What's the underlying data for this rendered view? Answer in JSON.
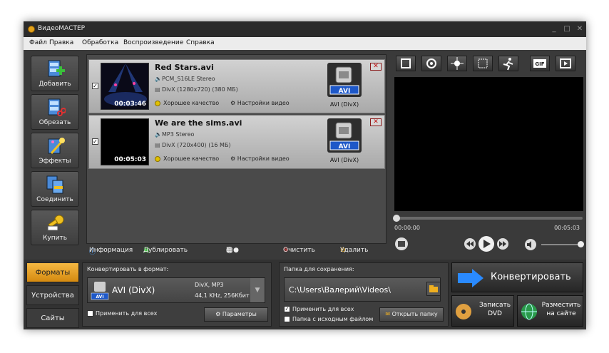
{
  "window": {
    "title": "ВидеоМАСТЕР",
    "controls": [
      "_",
      "□",
      "✕"
    ]
  },
  "menu": [
    "Файл",
    "Правка",
    "Обработка",
    "Воспроизведение",
    "Справка"
  ],
  "sidebar": [
    {
      "label": "Добавить",
      "icon": "add-video-icon"
    },
    {
      "label": "Обрезать",
      "icon": "cut-video-icon"
    },
    {
      "label": "Эффекты",
      "icon": "effects-icon"
    },
    {
      "label": "Соединить",
      "icon": "join-video-icon"
    },
    {
      "label": "Купить",
      "icon": "buy-key-icon"
    }
  ],
  "files": [
    {
      "checked": true,
      "title": "Red Stars.avi",
      "duration": "00:03:46",
      "audio": "PCM_S16LE Stereo",
      "video": "DivX (1280x720) (380 МБ)",
      "quality": "Хорошее качество",
      "settings": "Настройки видео",
      "format_badge": "AVI",
      "format_label": "AVI (DivX)"
    },
    {
      "checked": true,
      "title": "We are the sims.avi",
      "duration": "00:05:03",
      "audio": "MP3 Stereo",
      "video": "DivX (720x400) (16 МБ)",
      "quality": "Хорошее качество",
      "settings": "Настройки видео",
      "format_badge": "AVI",
      "format_label": "AVI (DivX)"
    }
  ],
  "filetoolbar": {
    "info": "Информация",
    "duplicate": "Дублировать",
    "clear": "Очистить",
    "delete": "Удалить"
  },
  "preview": {
    "tools": [
      "frame-icon",
      "snapshot-icon",
      "brightness-icon",
      "crop-icon",
      "speed-icon",
      "gif-icon",
      "fullscreen-icon"
    ],
    "gif_label": "GIF",
    "time_start": "00:00:00",
    "time_end": "00:05:03",
    "seek_progress": 0.0,
    "volume_level": 1.0
  },
  "tabs": [
    "Форматы",
    "Устройства",
    "Сайты"
  ],
  "convert_panel": {
    "label": "Конвертировать в формат:",
    "format": "AVI (DivX)",
    "badge": "AVI",
    "codec": "DivX, MP3",
    "params": "44,1 KHz, 256Кбит",
    "apply_all": "Применить для всех",
    "params_btn": "Параметры"
  },
  "save_panel": {
    "label": "Папка для сохранения:",
    "path": "C:\\Users\\Валерий\\Videos\\",
    "apply_all": "Применить для всех",
    "source_folder": "Папка с исходным файлом",
    "open_folder": "Открыть папку"
  },
  "actions": {
    "convert": "Конвертировать",
    "burn_dvd_line1": "Записать",
    "burn_dvd_line2": "DVD",
    "publish_line1": "Разместить",
    "publish_line2": "на сайте"
  },
  "colors": {
    "accent": "#e8a22a",
    "format_blue": "#1e58c8",
    "delete_red": "#c01010"
  }
}
